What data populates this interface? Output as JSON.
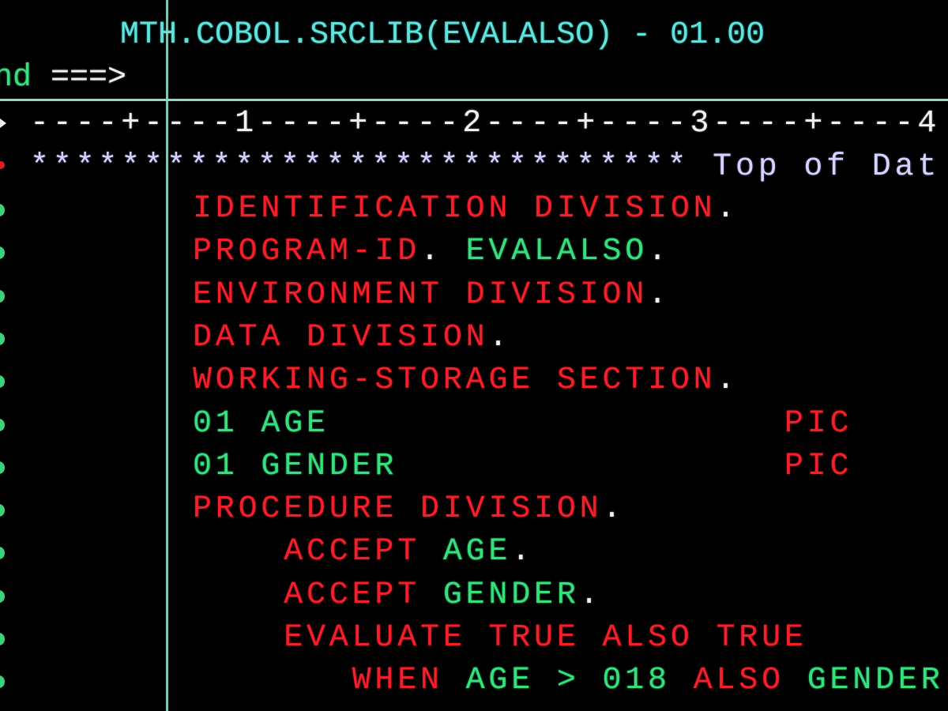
{
  "header": {
    "dataset_title": "MTH.COBOL.SRCLIB(EVALALSO) - 01.00",
    "command_label": "nd ===>",
    "command_value": ""
  },
  "ruler": "----+----1----+----2----+----3----+----4",
  "top_marker": {
    "stars": "*****************************",
    "label": "Top of Dat"
  },
  "lines": [
    {
      "indent": "",
      "segments": [
        {
          "text": "IDENTIFICATION DIVISION",
          "color": "red"
        },
        {
          "text": ".",
          "color": "white"
        }
      ]
    },
    {
      "indent": "",
      "segments": [
        {
          "text": "PROGRAM-ID",
          "color": "red"
        },
        {
          "text": ". ",
          "color": "white"
        },
        {
          "text": "EVALALSO",
          "color": "green"
        },
        {
          "text": ".",
          "color": "white"
        }
      ]
    },
    {
      "indent": "",
      "segments": [
        {
          "text": "ENVIRONMENT DIVISION",
          "color": "red"
        },
        {
          "text": ".",
          "color": "white"
        }
      ]
    },
    {
      "indent": "",
      "segments": [
        {
          "text": "DATA DIVISION",
          "color": "red"
        },
        {
          "text": ".",
          "color": "white"
        }
      ]
    },
    {
      "indent": "",
      "segments": [
        {
          "text": "WORKING-STORAGE SECTION",
          "color": "red"
        },
        {
          "text": ".",
          "color": "white"
        }
      ]
    },
    {
      "indent": "",
      "segments": [
        {
          "text": "01 AGE",
          "color": "green"
        },
        {
          "text": "                    ",
          "color": "white"
        },
        {
          "text": "PIC",
          "color": "red"
        }
      ]
    },
    {
      "indent": "",
      "segments": [
        {
          "text": "01 GENDER",
          "color": "green"
        },
        {
          "text": "                 ",
          "color": "white"
        },
        {
          "text": "PIC",
          "color": "red"
        }
      ]
    },
    {
      "indent": "",
      "segments": [
        {
          "text": "PROCEDURE DIVISION",
          "color": "red"
        },
        {
          "text": ".",
          "color": "white"
        }
      ]
    },
    {
      "indent": "    ",
      "segments": [
        {
          "text": "ACCEPT ",
          "color": "red"
        },
        {
          "text": "AGE",
          "color": "green"
        },
        {
          "text": ".",
          "color": "white"
        }
      ]
    },
    {
      "indent": "    ",
      "segments": [
        {
          "text": "ACCEPT ",
          "color": "red"
        },
        {
          "text": "GENDER",
          "color": "green"
        },
        {
          "text": ".",
          "color": "white"
        }
      ]
    },
    {
      "indent": "    ",
      "segments": [
        {
          "text": "EVALUATE TRUE ALSO TRUE",
          "color": "red"
        }
      ]
    },
    {
      "indent": "       ",
      "segments": [
        {
          "text": "WHEN ",
          "color": "red"
        },
        {
          "text": "AGE > 018 ",
          "color": "green"
        },
        {
          "text": "ALSO ",
          "color": "red"
        },
        {
          "text": "GENDER",
          "color": "green"
        }
      ]
    }
  ],
  "colors": {
    "background": "#000000",
    "title": "#5fe3dc",
    "keyword": "#f0202c",
    "identifier": "#38e07a",
    "punctuation": "#f2f2f2",
    "stars": "#d4d4ff",
    "separator": "#8fd8c8"
  }
}
